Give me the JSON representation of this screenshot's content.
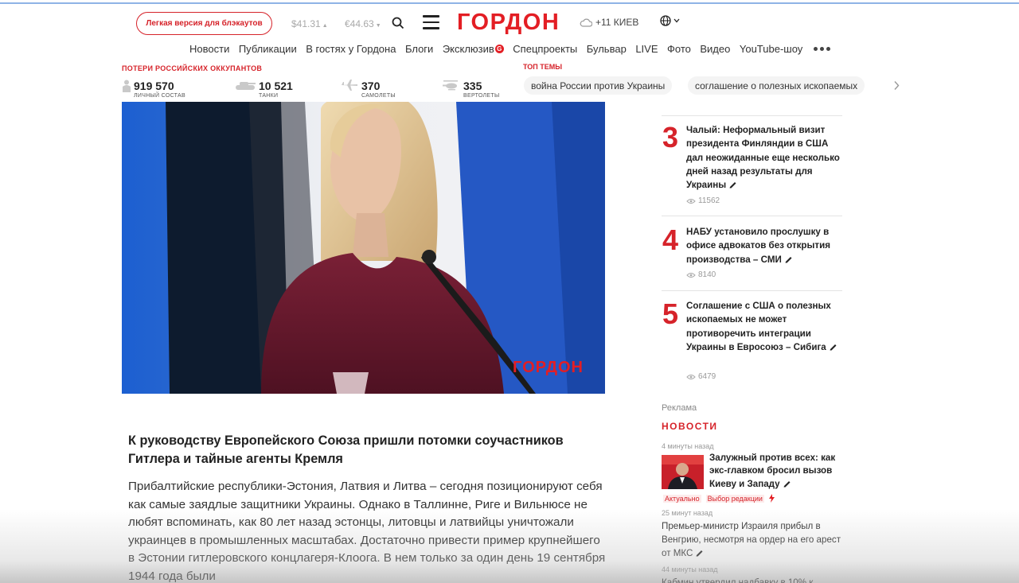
{
  "header": {
    "light_version": "Легкая версия для блэкаутов",
    "usd": "$41.31",
    "eur": "€44.63",
    "logo": "ГОРДОН",
    "weather": "+11 КИЕВ",
    "icons": [
      "search-icon",
      "menu-icon",
      "cloud-icon",
      "globe-icon"
    ]
  },
  "nav": {
    "items": [
      "Новости",
      "Публикации",
      "В гостях у Гордона",
      "Блоги",
      "Эксклюзив",
      "Спецпроекты",
      "Бульвар",
      "LIVE",
      "Фото",
      "Видео",
      "YouTube-шоу"
    ],
    "exclusive_badge": "G"
  },
  "losses": {
    "title": "ПОТЕРИ РОССИЙСКИХ ОККУПАНТОВ",
    "items": [
      {
        "value": "919 570",
        "label": "ЛИЧНЫЙ СОСТАВ"
      },
      {
        "value": "10 521",
        "label": "ТАНКИ"
      },
      {
        "value": "370",
        "label": "САМОЛЕТЫ"
      },
      {
        "value": "335",
        "label": "ВЕРТОЛЕТЫ"
      }
    ]
  },
  "top_topics": {
    "title": "ТОП ТЕМЫ",
    "items": [
      "война России против Украины",
      "соглашение о полезных ископаемых"
    ]
  },
  "photo": {
    "watermark": "ГОРДОН"
  },
  "article": {
    "headline": "К руководству Европейского Союза пришли потомки соучастников Гитлера и тайные агенты Кремля",
    "lead": "Прибалтийские республики-Эстония, Латвия и Литва – сегодня позиционируют себя как самые заядлые защитники Украины. Однако в Таллинне, Риге и Вильнюсе не любят вспоминать, как 80 лет назад эстонцы, литовцы и латвийцы уничтожали украинцев в промышленных масштабах. Достаточно привести пример крупнейшего в Эстонии гитлеровского концлагеря-Клоога. В нем только за один день 19 сентября 1944 года были"
  },
  "popular": [
    {
      "rank": "3",
      "title": "Чалый: Неформальный визит президента Финляндии в США дал неожиданные еще несколько дней назад результаты для Украины",
      "views": "11562"
    },
    {
      "rank": "4",
      "title": "НАБУ установило прослушку в офисе адвокатов без открытия производства – СМИ",
      "views": "8140"
    },
    {
      "rank": "5",
      "title": "Соглашение с США о полезных ископаемых не может противоречить интеграции Украины в Евросоюз – Сибига",
      "views": "6479"
    }
  ],
  "news": {
    "ad_label": "Реклама",
    "title": "НОВОСТИ",
    "items": [
      {
        "time": "4 минуты назад",
        "title": "Залужный против всех: как экс-главком бросил вызов Киеву и Западу",
        "tags": [
          "Актуально",
          "Выбор редакции"
        ]
      },
      {
        "time": "25 минут назад",
        "title": "Премьер-министр Израиля прибыл в Венгрию, несмотря на ордер на его арест от МКС"
      },
      {
        "time": "44 минуты назад",
        "title": "Кабмин утвердил надбавку в 10% к"
      }
    ]
  }
}
